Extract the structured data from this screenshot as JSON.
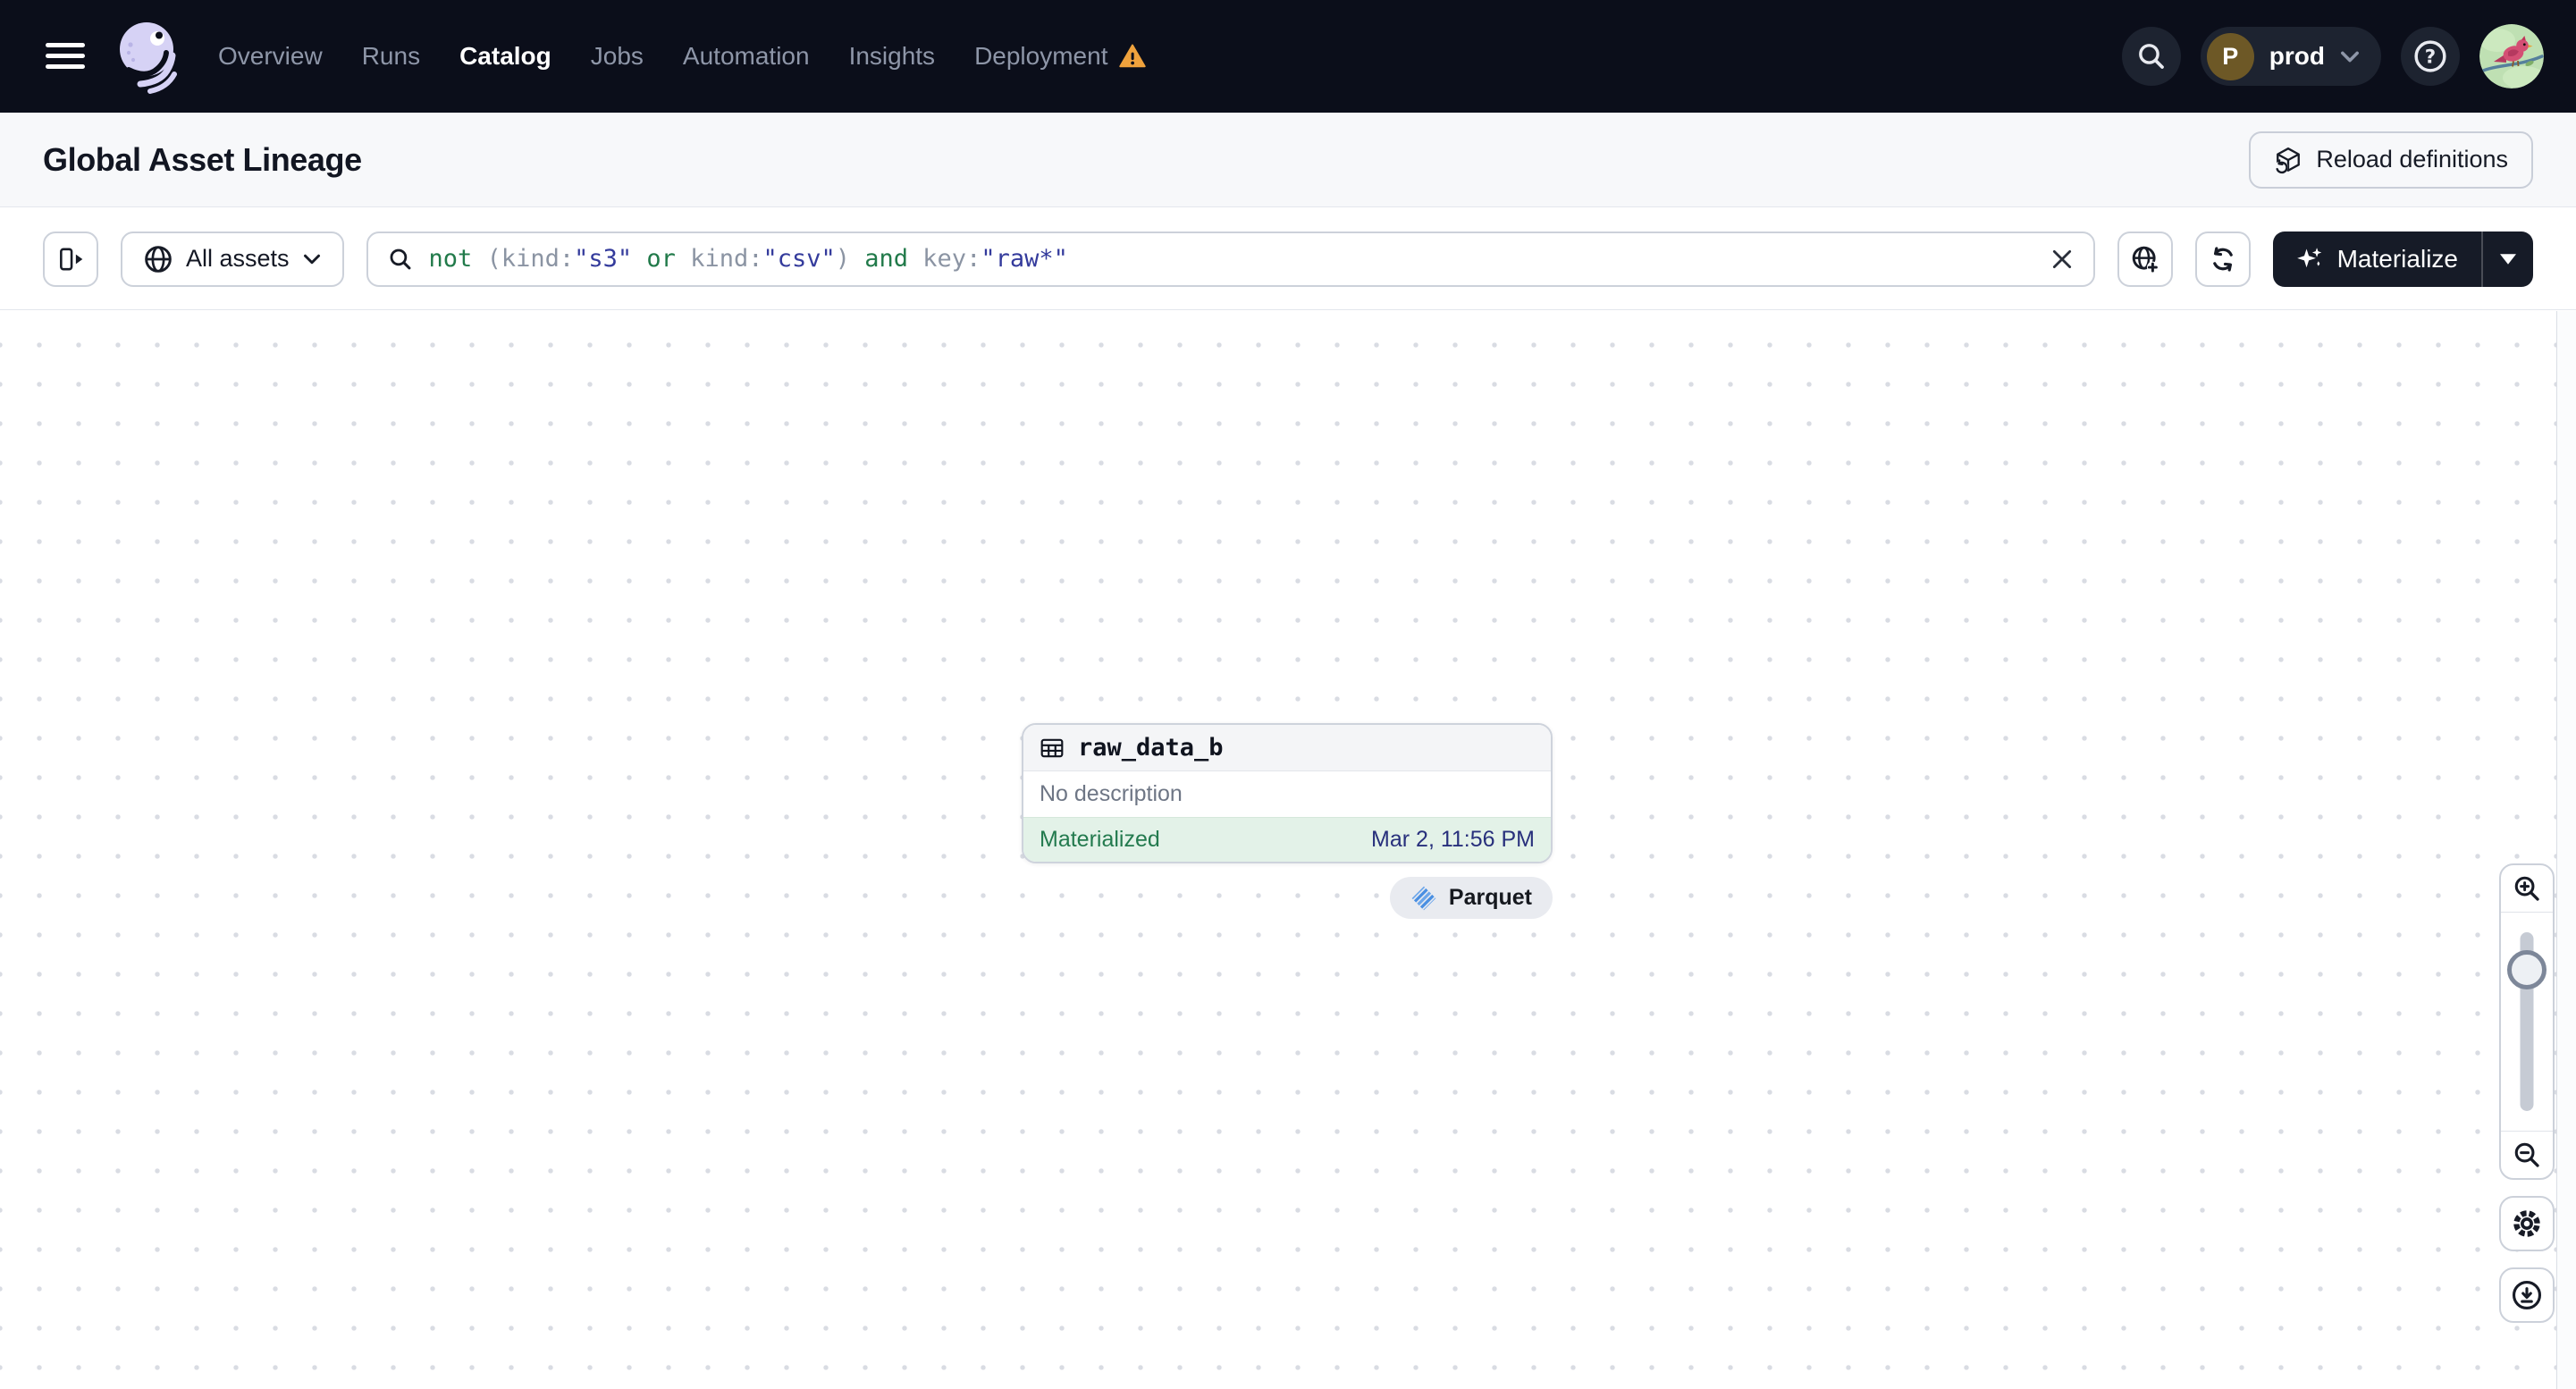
{
  "nav": {
    "items": [
      "Overview",
      "Runs",
      "Catalog",
      "Jobs",
      "Automation",
      "Insights",
      "Deployment"
    ],
    "active_item": "Catalog",
    "environment": {
      "initial": "P",
      "name": "prod"
    }
  },
  "page_header": {
    "title": "Global Asset Lineage",
    "reload_button_label": "Reload definitions"
  },
  "toolbar": {
    "scope_button_label": "All assets",
    "materialize_button_label": "Materialize",
    "search": {
      "full_query": "not (kind:\"s3\" or kind:\"csv\") and key:\"raw*\"",
      "segments": [
        {
          "text": "not ",
          "type": "operator"
        },
        {
          "text": "(kind:",
          "type": "key"
        },
        {
          "text": "\"s3\"",
          "type": "value"
        },
        {
          "text": " or ",
          "type": "operator"
        },
        {
          "text": "kind:",
          "type": "key"
        },
        {
          "text": "\"csv\"",
          "type": "value"
        },
        {
          "text": ") ",
          "type": "key"
        },
        {
          "text": "and ",
          "type": "operator"
        },
        {
          "text": "key:",
          "type": "key"
        },
        {
          "text": "\"raw*\"",
          "type": "value"
        }
      ]
    }
  },
  "graph": {
    "node": {
      "name": "raw_data_b",
      "description": "No description",
      "status": "Materialized",
      "last_materialized": "Mar 2, 11:56 PM",
      "kind_tag": "Parquet"
    }
  },
  "colors": {
    "nav_background": "#0b0e1a",
    "warning_orange": "#f0a23d",
    "status_green": "#237a4e",
    "timestamp_indigo": "#28307c",
    "query_operator_green": "#217a4a",
    "query_value_indigo": "#343b9c",
    "materialize_button": "#161b27",
    "node_footer_green": "#e3f2e8",
    "parquet_blue": "#4a8fe2"
  }
}
